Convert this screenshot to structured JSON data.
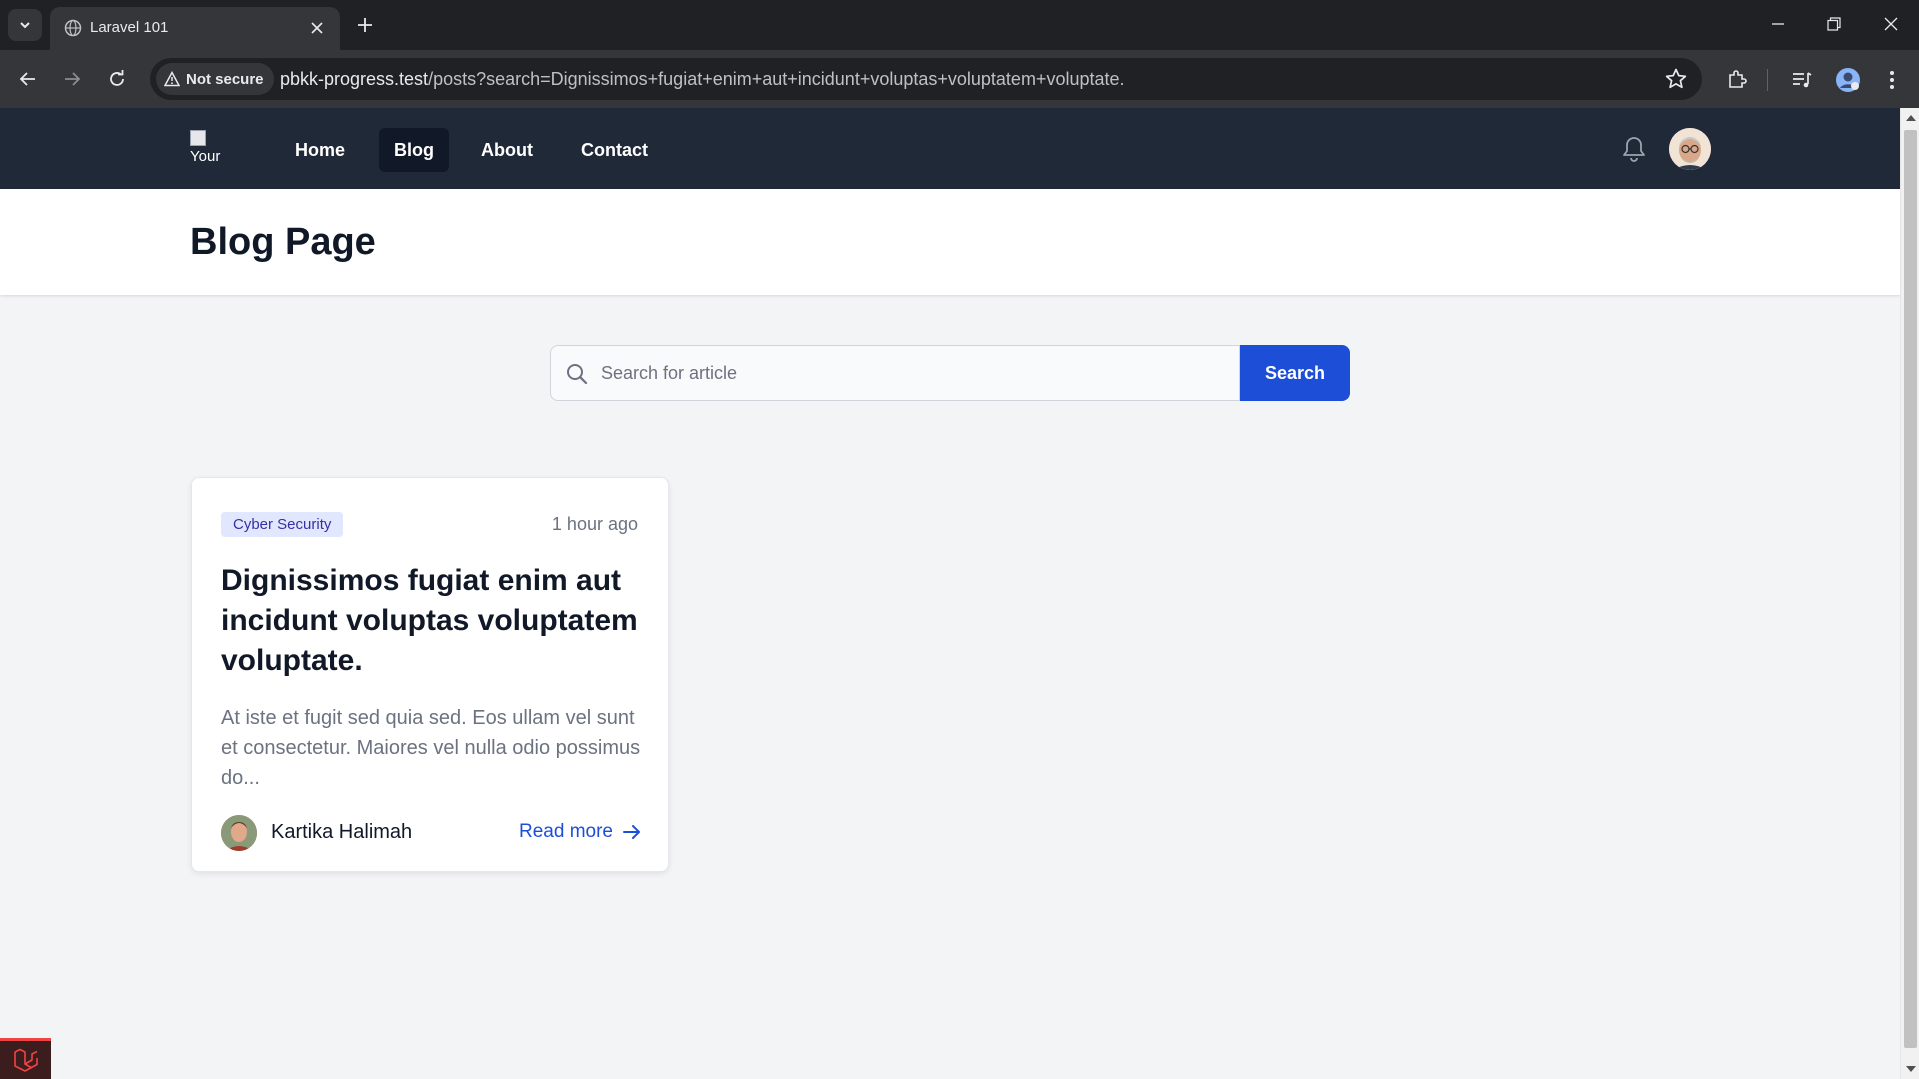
{
  "browser": {
    "tab_title": "Laravel 101",
    "security_label": "Not secure",
    "url_host": "pbkk-progress.test",
    "url_path": "/posts?search=Dignissimos+fugiat+enim+aut+incidunt+voluptas+voluptatem+voluptate."
  },
  "site": {
    "logo_alt": "Your",
    "nav": [
      {
        "label": "Home",
        "active": false
      },
      {
        "label": "Blog",
        "active": true
      },
      {
        "label": "About",
        "active": false
      },
      {
        "label": "Contact",
        "active": false
      }
    ]
  },
  "header": {
    "title": "Blog Page"
  },
  "search": {
    "placeholder": "Search for article",
    "value": "",
    "button_label": "Search"
  },
  "posts": [
    {
      "category": "Cyber Security",
      "time": "1 hour ago",
      "title": "Dignissimos fugiat enim aut incidunt voluptas voluptatem voluptate.",
      "excerpt": "At iste et fugit sed quia sed. Eos ullam vel sunt et consectetur. Maiores vel nulla odio possimus do...",
      "author": "Kartika Halimah",
      "read_more": "Read more"
    }
  ],
  "colors": {
    "nav_bg": "#1f2937",
    "accent": "#1d4ed8",
    "badge_bg": "#e0e7ff",
    "badge_text": "#3730a3"
  }
}
